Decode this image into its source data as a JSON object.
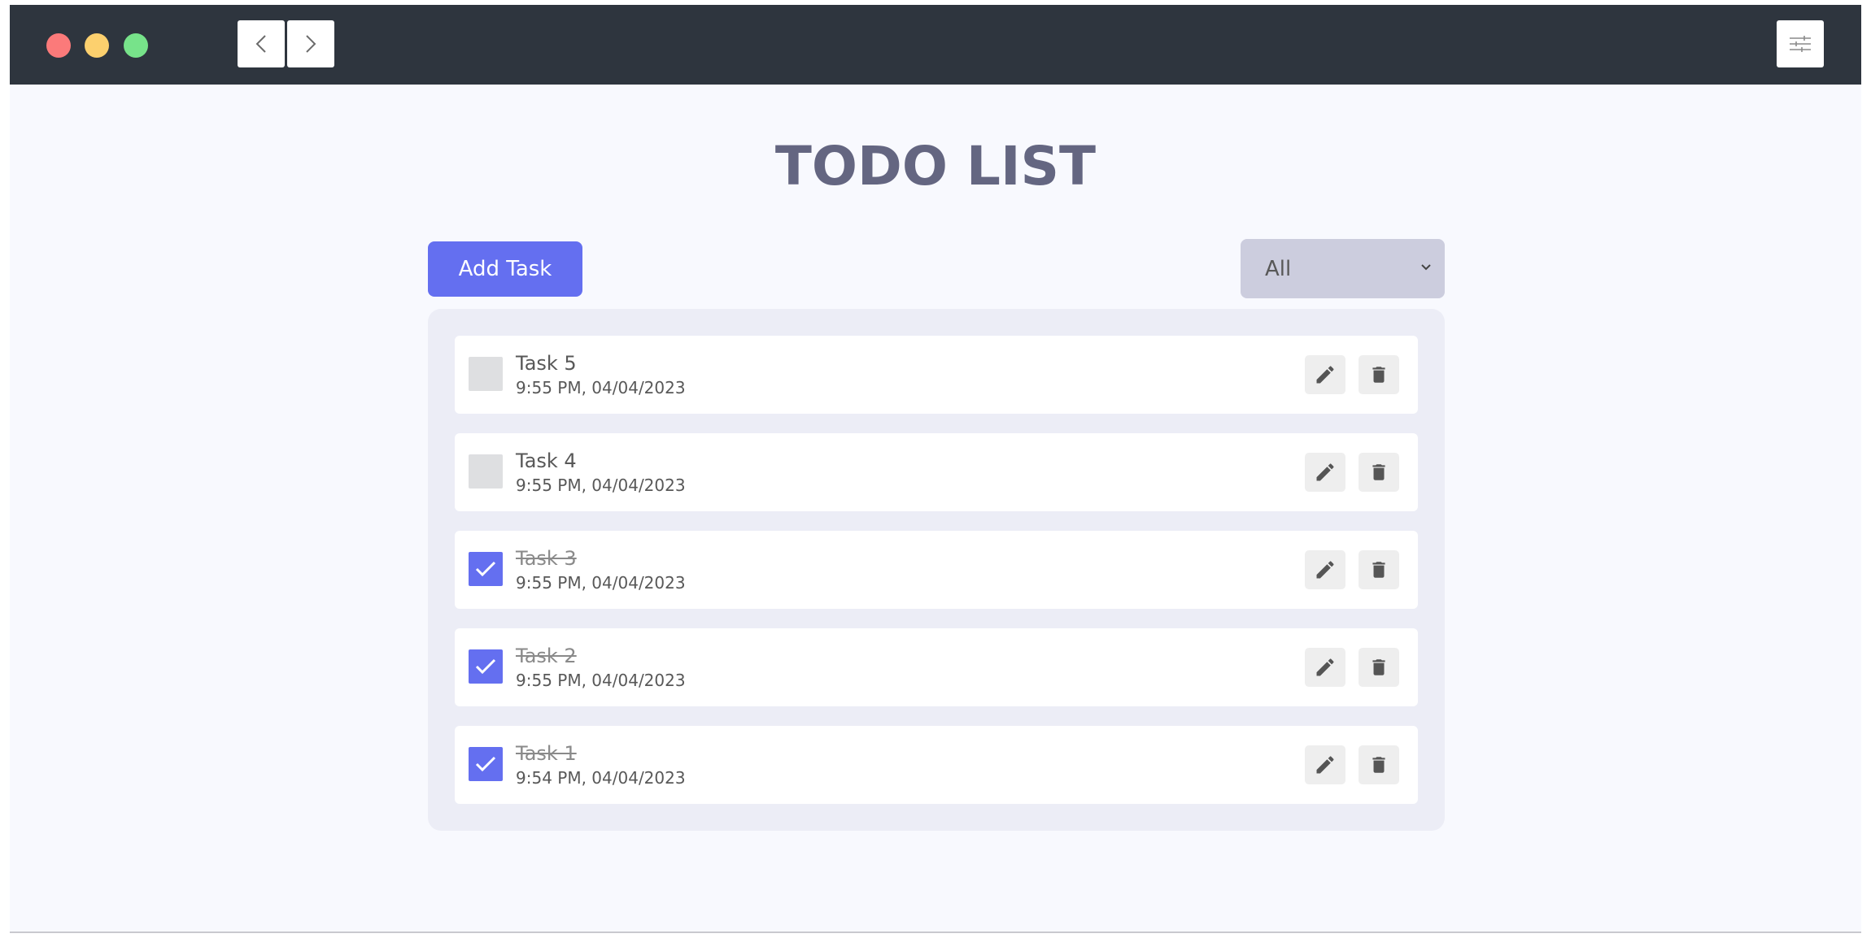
{
  "window": {
    "controls": [
      "close",
      "minimize",
      "maximize"
    ],
    "nav": {
      "back_icon": "chevron-left-icon",
      "forward_icon": "chevron-right-icon"
    },
    "settings_icon": "sliders-icon"
  },
  "app": {
    "title": "TODO LIST",
    "add_button_label": "Add Task",
    "filter": {
      "selected": "All"
    },
    "colors": {
      "accent": "#646ff0",
      "title": "#646681",
      "panel": "#ecedf6"
    }
  },
  "tasks": [
    {
      "name": "Task 5",
      "time": "9:55 PM, 04/04/2023",
      "completed": false
    },
    {
      "name": "Task 4",
      "time": "9:55 PM, 04/04/2023",
      "completed": false
    },
    {
      "name": "Task 3",
      "time": "9:55 PM, 04/04/2023",
      "completed": true
    },
    {
      "name": "Task 2",
      "time": "9:55 PM, 04/04/2023",
      "completed": true
    },
    {
      "name": "Task 1",
      "time": "9:54 PM, 04/04/2023",
      "completed": true
    }
  ]
}
